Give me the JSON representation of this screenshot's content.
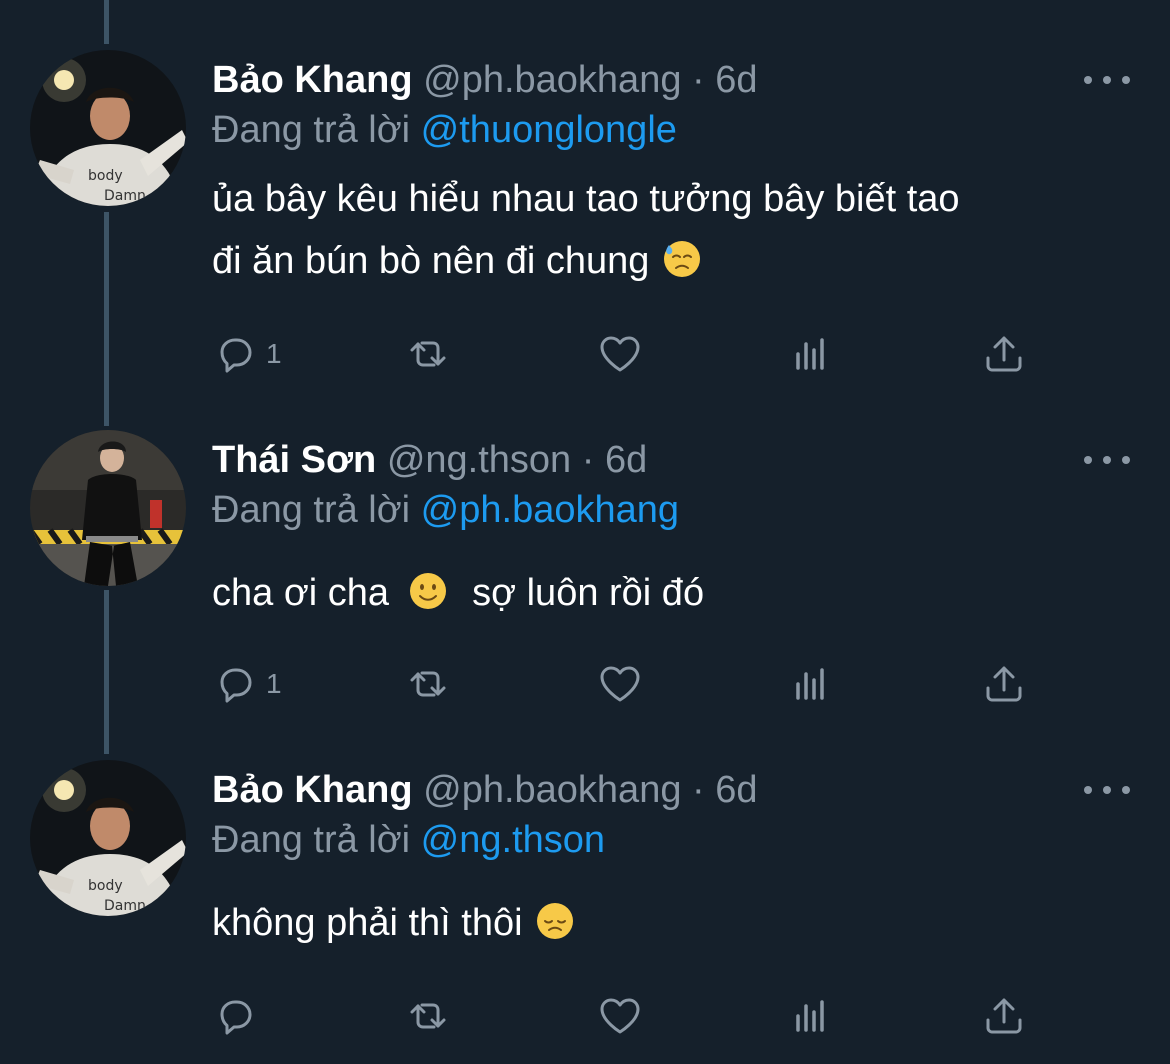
{
  "tweets": [
    {
      "name": "Bảo Khang",
      "handle": "@ph.baokhang",
      "separator": "·",
      "time": "6d",
      "reply_prefix": "Đang trả lời",
      "reply_to": "@thuonglongle",
      "text_lines": [
        "ủa bây kêu hiểu nhau tao tưởng bây biết tao",
        "đi ăn bún bò nên đi chung"
      ],
      "emoji": "downcast-face-with-sweat",
      "reply_count": "1",
      "avatar": "bao-khang-avatar"
    },
    {
      "name": "Thái Sơn",
      "handle": "@ng.thson",
      "separator": "·",
      "time": "6d",
      "reply_prefix": "Đang trả lời",
      "reply_to": "@ph.baokhang",
      "text_before": "cha ơi cha",
      "text_after": "sợ luôn rồi đó",
      "emoji": "slightly-smiling-face",
      "reply_count": "1",
      "avatar": "thai-son-avatar"
    },
    {
      "name": "Bảo Khang",
      "handle": "@ph.baokhang",
      "separator": "·",
      "time": "6d",
      "reply_prefix": "Đang trả lời",
      "reply_to": "@ng.thson",
      "text": "không phải thì thôi",
      "emoji": "pensive-face",
      "reply_count": "",
      "avatar": "bao-khang-avatar"
    }
  ],
  "colors": {
    "background": "#15202b",
    "muted": "#8b98a5",
    "link": "#1d9bf0",
    "thread_line": "#3d5466"
  }
}
